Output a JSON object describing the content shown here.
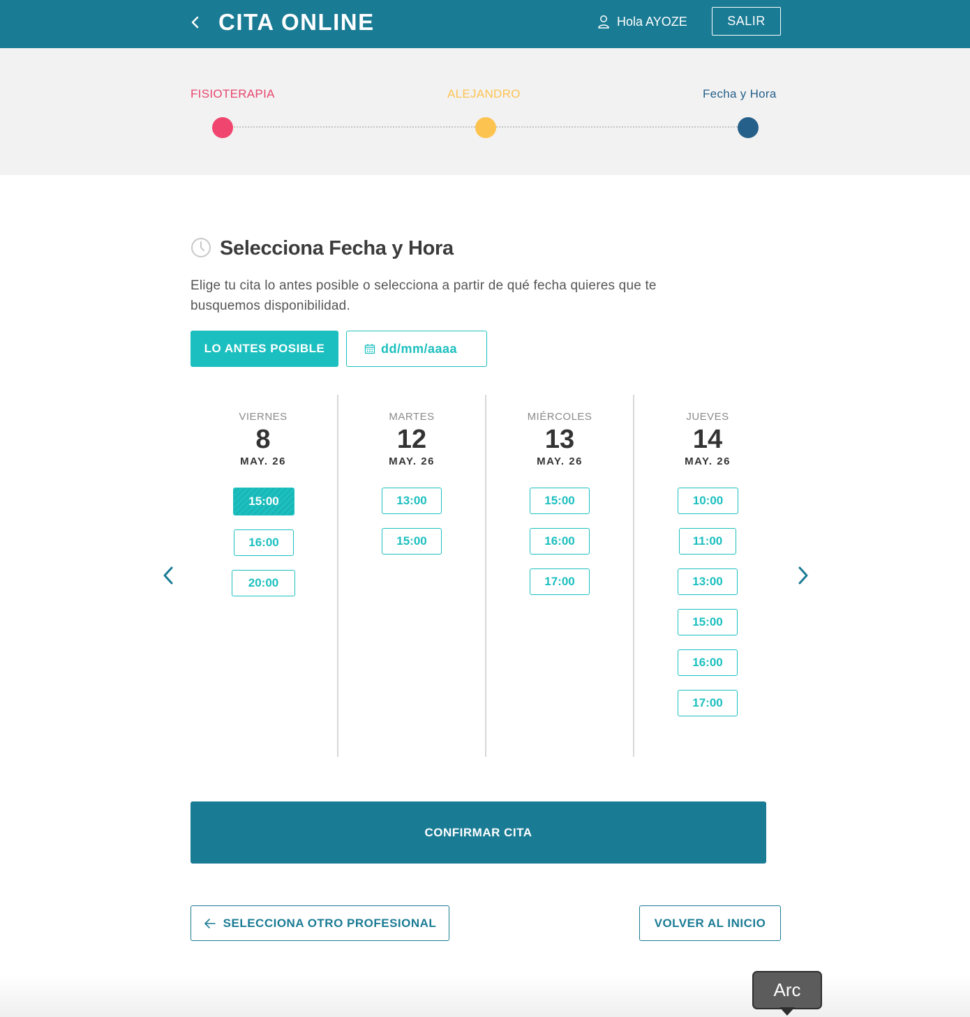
{
  "header": {
    "title": "CITA ONLINE",
    "greeting": "Hola AYOZE",
    "logout_label": "SALIR"
  },
  "stepper": {
    "steps": [
      {
        "label": "FISIOTERAPIA",
        "color": "#e8466d"
      },
      {
        "label": "ALEJANDRO",
        "color": "#fdc351"
      },
      {
        "label": "Fecha y Hora",
        "color": "#26608a"
      }
    ]
  },
  "section": {
    "title": "Selecciona Fecha y Hora",
    "description": "Elige tu cita lo antes posible o selecciona a partir de qué fecha quieres que te busquemos disponibilidad.",
    "asap_label": "LO ANTES POSIBLE",
    "date_placeholder": "dd/mm/aaaa"
  },
  "calendar": {
    "days": [
      {
        "weekday": "VIERNES",
        "day": "8",
        "month": "MAY. 26",
        "slots": [
          "15:00",
          "16:00",
          "20:00"
        ],
        "selected": "15:00"
      },
      {
        "weekday": "MARTES",
        "day": "12",
        "month": "MAY. 26",
        "slots": [
          "13:00",
          "15:00"
        ]
      },
      {
        "weekday": "MIÉRCOLES",
        "day": "13",
        "month": "MAY. 26",
        "slots": [
          "15:00",
          "16:00",
          "17:00"
        ]
      },
      {
        "weekday": "JUEVES",
        "day": "14",
        "month": "MAY. 26",
        "slots": [
          "10:00",
          "11:00",
          "13:00",
          "15:00",
          "16:00",
          "17:00"
        ]
      }
    ]
  },
  "actions": {
    "confirm_label": "CONFIRMAR CITA",
    "other_professional_label": "SELECCIONA OTRO PROFESIONAL",
    "home_label": "VOLVER AL INICIO"
  },
  "tooltip": {
    "label": "Arc"
  },
  "colors": {
    "header": "#1a7b94",
    "accent": "#1cbfbf",
    "step_1": "#f0456e",
    "step_2": "#fdc351",
    "step_3": "#25608a"
  }
}
